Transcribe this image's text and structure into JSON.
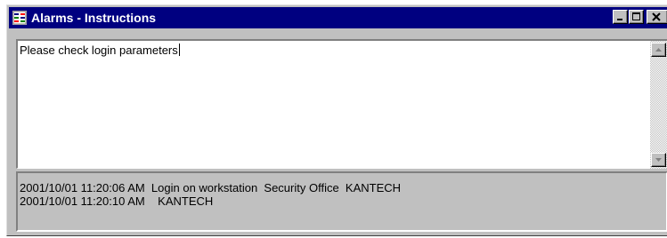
{
  "window": {
    "title": "Alarms - Instructions"
  },
  "instructions": {
    "text": "Please check login parameters"
  },
  "log": {
    "lines": [
      "2001/10/01 11:20:06 AM  Login on workstation  Security Office  KANTECH",
      "2001/10/01 11:20:10 AM    KANTECH"
    ]
  },
  "colors": {
    "titlebar": "#000080",
    "window_face": "#c0c0c0"
  },
  "icons": {
    "app": "alarm-grid-icon",
    "minimize": "minimize-icon",
    "maximize": "maximize-icon",
    "close": "close-icon",
    "scroll_up": "arrow-up-icon",
    "scroll_down": "arrow-down-icon"
  }
}
